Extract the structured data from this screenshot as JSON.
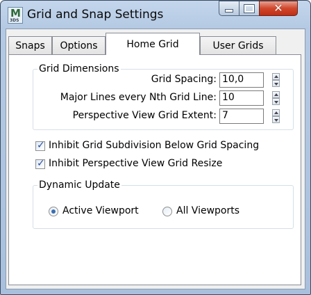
{
  "window": {
    "title": "Grid and Snap Settings",
    "icon_main": "M",
    "icon_sub": "3DS",
    "close_glyph": "✕"
  },
  "tabs": [
    {
      "label": "Snaps",
      "active": false
    },
    {
      "label": "Options",
      "active": false
    },
    {
      "label": "Home Grid",
      "active": true
    },
    {
      "label": "User Grids",
      "active": false
    }
  ],
  "grid_dimensions": {
    "legend": "Grid Dimensions",
    "grid_spacing": {
      "label": "Grid Spacing:",
      "value": "10,0"
    },
    "major_lines": {
      "label": "Major Lines every Nth Grid Line:",
      "value": "10"
    },
    "perspective_extent": {
      "label": "Perspective View Grid Extent:",
      "value": "7"
    }
  },
  "options": {
    "inhibit_subdivision": {
      "label": "Inhibit Grid Subdivision Below Grid Spacing",
      "checked": true
    },
    "inhibit_perspective_resize": {
      "label": "Inhibit Perspective View Grid Resize",
      "checked": true
    }
  },
  "dynamic_update": {
    "legend": "Dynamic Update",
    "active_viewport": {
      "label": "Active Viewport",
      "selected": true
    },
    "all_viewports": {
      "label": "All Viewports",
      "selected": false
    }
  },
  "colors": {
    "title_bar": "#b4c9e3",
    "close_button": "#c9442a",
    "accent": "#3b6fb0"
  }
}
